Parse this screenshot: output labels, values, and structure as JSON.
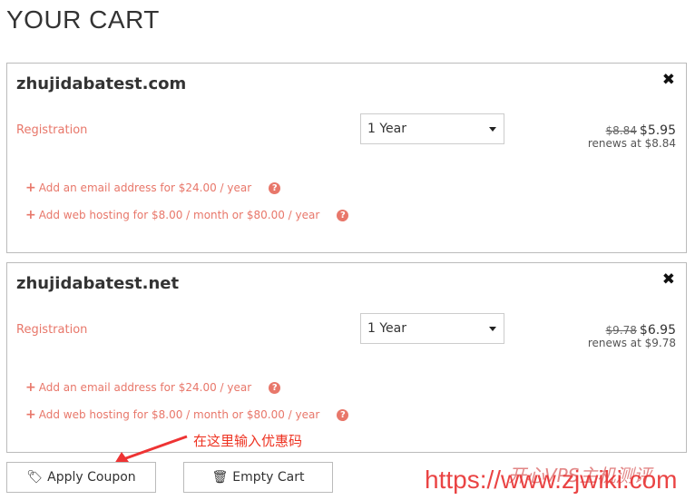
{
  "page_title": "YOUR CART",
  "items": [
    {
      "domain": "zhujidabatest.com",
      "type": "Registration",
      "period": "1 Year",
      "old_price": "$8.84",
      "price": "$5.95",
      "renews": "renews at $8.84",
      "addons": [
        "Add an email address for $24.00 / year",
        "Add web hosting for $8.00 / month or $80.00 / year"
      ]
    },
    {
      "domain": "zhujidabatest.net",
      "type": "Registration",
      "period": "1 Year",
      "old_price": "$9.78",
      "price": "$6.95",
      "renews": "renews at $9.78",
      "addons": [
        "Add an email address for $24.00 / year",
        "Add web hosting for $8.00 / month or $80.00 / year"
      ]
    }
  ],
  "buttons": {
    "apply_coupon": "Apply Coupon",
    "empty_cart": "Empty Cart"
  },
  "annotation": "在这里输入优惠码",
  "watermark": {
    "url": "https://www.zjwiki.com",
    "cn": "开心VPS主机测评"
  },
  "colors": {
    "accent": "#e8776a",
    "annotation": "#e33322"
  }
}
